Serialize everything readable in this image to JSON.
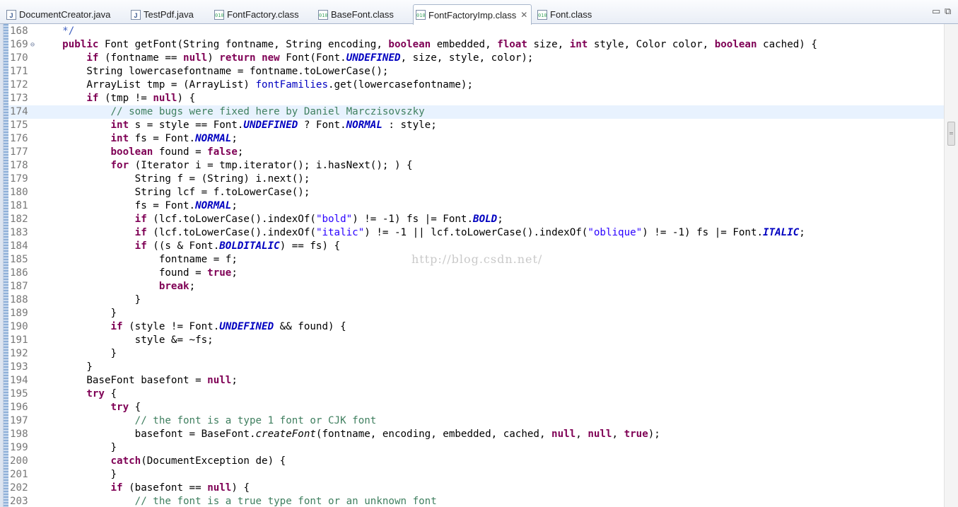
{
  "tabs": [
    {
      "label": "DocumentCreator.java",
      "icon": "java-file-icon",
      "glyph": "J"
    },
    {
      "label": "TestPdf.java",
      "icon": "java-file-icon",
      "glyph": "J"
    },
    {
      "label": "FontFactory.class",
      "icon": "class-file-icon",
      "glyph": "010"
    },
    {
      "label": "BaseFont.class",
      "icon": "class-file-icon",
      "glyph": "010"
    },
    {
      "label": "FontFactoryImp.class",
      "icon": "class-file-icon",
      "glyph": "010",
      "active": true,
      "close": "✕"
    },
    {
      "label": "Font.class",
      "icon": "class-file-icon",
      "glyph": "010"
    }
  ],
  "window_controls": {
    "minimize": "▭",
    "restore": "⧉"
  },
  "watermark": "http://blog.csdn.net/",
  "code_lines": [
    {
      "n": "168",
      "html": "    <span class='jd'>*/</span>"
    },
    {
      "n": "169",
      "fold": "⊖",
      "html": "    <span class='kw'>public</span> Font getFont(String fontname, String encoding, <span class='kw'>boolean</span> embedded, <span class='kw'>float</span> size, <span class='kw'>int</span> style, Color color, <span class='kw'>boolean</span> cached) {"
    },
    {
      "n": "170",
      "html": "        <span class='kw'>if</span> (fontname == <span class='kw'>null</span>) <span class='kw'>return</span> <span class='kw'>new</span> Font(Font.<span class='sf'>UNDEFINED</span>, size, style, color);"
    },
    {
      "n": "171",
      "html": "        String lowercasefontname = fontname.toLowerCase();"
    },
    {
      "n": "172",
      "html": "        ArrayList tmp = (ArrayList) <span class='fd'>fontFamilies</span>.get(lowercasefontname);"
    },
    {
      "n": "173",
      "html": "        <span class='kw'>if</span> (tmp != <span class='kw'>null</span>) {"
    },
    {
      "n": "174",
      "hl": true,
      "html": "            <span class='cm'>// some bugs were fixed here by Daniel Marczisovszky</span>"
    },
    {
      "n": "175",
      "html": "            <span class='kw'>int</span> s = style == Font.<span class='sf'>UNDEFINED</span> ? Font.<span class='sf'>NORMAL</span> : style;"
    },
    {
      "n": "176",
      "html": "            <span class='kw'>int</span> fs = Font.<span class='sf'>NORMAL</span>;"
    },
    {
      "n": "177",
      "html": "            <span class='kw'>boolean</span> found = <span class='kw'>false</span>;"
    },
    {
      "n": "178",
      "html": "            <span class='kw'>for</span> (Iterator i = tmp.iterator(); i.hasNext(); ) {"
    },
    {
      "n": "179",
      "html": "                String f = (String) i.next();"
    },
    {
      "n": "180",
      "html": "                String lcf = f.toLowerCase();"
    },
    {
      "n": "181",
      "html": "                fs = Font.<span class='sf'>NORMAL</span>;"
    },
    {
      "n": "182",
      "html": "                <span class='kw'>if</span> (lcf.toLowerCase().indexOf(<span class='st'>\"bold\"</span>) != -1) fs |= Font.<span class='sf'>BOLD</span>;"
    },
    {
      "n": "183",
      "html": "                <span class='kw'>if</span> (lcf.toLowerCase().indexOf(<span class='st'>\"italic\"</span>) != -1 || lcf.toLowerCase().indexOf(<span class='st'>\"oblique\"</span>) != -1) fs |= Font.<span class='sf'>ITALIC</span>;"
    },
    {
      "n": "184",
      "html": "                <span class='kw'>if</span> ((s &amp; Font.<span class='sf'>BOLDITALIC</span>) == fs) {"
    },
    {
      "n": "185",
      "html": "                    fontname = f;"
    },
    {
      "n": "186",
      "html": "                    found = <span class='kw'>true</span>;"
    },
    {
      "n": "187",
      "html": "                    <span class='kw'>break</span>;"
    },
    {
      "n": "188",
      "html": "                }"
    },
    {
      "n": "189",
      "html": "            }"
    },
    {
      "n": "190",
      "html": "            <span class='kw'>if</span> (style != Font.<span class='sf'>UNDEFINED</span> &amp;&amp; found) {"
    },
    {
      "n": "191",
      "html": "                style &amp;= ~fs;"
    },
    {
      "n": "192",
      "html": "            }"
    },
    {
      "n": "193",
      "html": "        }"
    },
    {
      "n": "194",
      "html": "        BaseFont basefont = <span class='kw'>null</span>;"
    },
    {
      "n": "195",
      "html": "        <span class='kw'>try</span> {"
    },
    {
      "n": "196",
      "html": "            <span class='kw'>try</span> {"
    },
    {
      "n": "197",
      "html": "                <span class='cm'>// the font is a type 1 font or CJK font</span>"
    },
    {
      "n": "198",
      "html": "                basefont = BaseFont.<span class='it'>createFont</span>(fontname, encoding, embedded, cached, <span class='kw'>null</span>, <span class='kw'>null</span>, <span class='kw'>true</span>);"
    },
    {
      "n": "199",
      "html": "            }"
    },
    {
      "n": "200",
      "html": "            <span class='kw'>catch</span>(DocumentException de) {"
    },
    {
      "n": "201",
      "html": "            }"
    },
    {
      "n": "202",
      "html": "            <span class='kw'>if</span> (basefont == <span class='kw'>null</span>) {"
    },
    {
      "n": "203",
      "html": "                <span class='cm'>// the font is a true type font or an unknown font</span>"
    }
  ],
  "colors": {
    "keyword": "#7f0055",
    "comment": "#3f7f5f",
    "string": "#2a00ff",
    "static_field": "#0000c0",
    "current_line": "#e8f2fe"
  }
}
